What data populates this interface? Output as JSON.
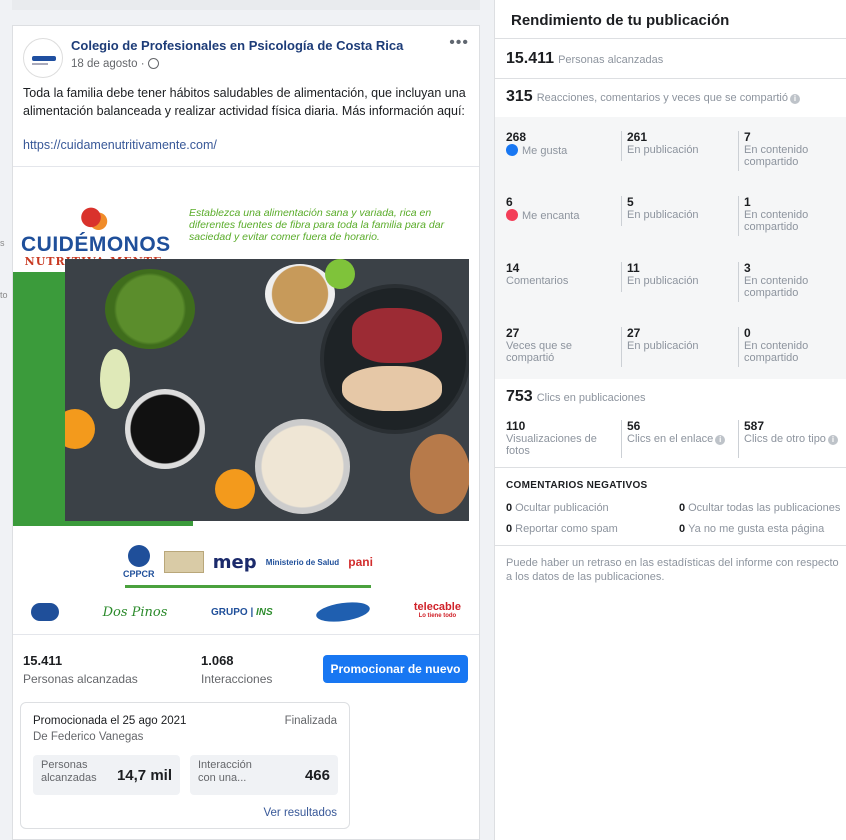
{
  "left_edge": {
    "items": [
      "s",
      "to"
    ]
  },
  "post": {
    "page_name": "Colegio de Profesionales en Psicología de Costa Rica",
    "date": "18 de agosto ·",
    "more": "•••",
    "text": "Toda la familia debe tener hábitos saludables de alimentación, que incluyan una alimentación balanceada y realizar actividad física diaria. Más información aquí:",
    "link": "https://cuidamenutritivamente.com/",
    "image": {
      "logo_title": "CUIDÉMONOS",
      "logo_sub": "NUTRITIVA·MENTE",
      "banner_text": "Establezca una alimentación sana y variada, rica en diferentes fuentes de fibra para toda la familia para dar saciedad y evitar comer fuera de horario.",
      "sponsors_row1": {
        "cppcr": "CPPCR",
        "mep": "mep",
        "salud": "Ministerio de Salud",
        "pani": "pani"
      },
      "sponsors_row2": {
        "dospinos": "Dos Pinos",
        "grupo": "GRUPO |",
        "ins": "INS",
        "telecable": "telecable",
        "telecable_sub": "Lo tiene todo"
      }
    },
    "stats": {
      "reach_value": "15.411",
      "reach_label": "Personas alcanzadas",
      "interactions_value": "1.068",
      "interactions_label": "Interacciones",
      "promote_label": "Promocionar de nuevo"
    },
    "promo": {
      "title": "Promocionada el 25 ago 2021",
      "status": "Finalizada",
      "by": "De Federico Vanegas",
      "reach_label": "Personas alcanzadas",
      "reach_value": "14,7 mil",
      "interaction_label": "Interacción con una...",
      "interaction_value": "466",
      "see_results": "Ver resultados"
    }
  },
  "performance": {
    "title": "Rendimiento de tu publicación",
    "reached_value": "15.411",
    "reached_label": "Personas alcanzadas",
    "engagement_value": "315",
    "engagement_label": "Reacciones, comentarios y veces que se compartió",
    "grid": [
      {
        "total": "268",
        "label": "Me gusta",
        "post": "261",
        "post_label": "En publicación",
        "shared": "7",
        "shared_label": "En contenido compartido"
      },
      {
        "total": "6",
        "label": "Me encanta",
        "post": "5",
        "post_label": "En publicación",
        "shared": "1",
        "shared_label": "En contenido compartido"
      },
      {
        "total": "14",
        "label": "Comentarios",
        "post": "11",
        "post_label": "En publicación",
        "shared": "3",
        "shared_label": "En contenido compartido"
      },
      {
        "total": "27",
        "label": "Veces que se compartió",
        "post": "27",
        "post_label": "En publicación",
        "shared": "0",
        "shared_label": "En contenido compartido"
      }
    ],
    "clicks_value": "753",
    "clicks_label": "Clics en publicaciones",
    "clicks": [
      {
        "value": "110",
        "label": "Visualizaciones de fotos"
      },
      {
        "value": "56",
        "label": "Clics en el enlace"
      },
      {
        "value": "587",
        "label": "Clics de otro tipo"
      }
    ],
    "negative_title": "COMENTARIOS NEGATIVOS",
    "negative": [
      {
        "value": "0",
        "label": "Ocultar publicación"
      },
      {
        "value": "0",
        "label": "Ocultar todas las publicaciones"
      },
      {
        "value": "0",
        "label": "Reportar como spam"
      },
      {
        "value": "0",
        "label": "Ya no me gusta esta página"
      }
    ],
    "disclaimer": "Puede haber un retraso en las estadísticas del informe con respecto a los datos de las publicaciones."
  },
  "colors": {
    "accent": "#1877f2",
    "link": "#385898",
    "page_name": "#1d3c78"
  }
}
